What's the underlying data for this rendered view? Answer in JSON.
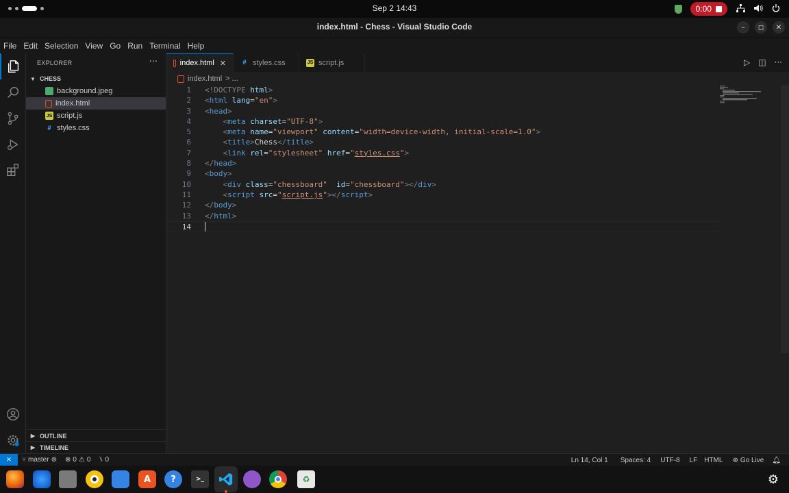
{
  "topbar": {
    "clock": "Sep 2  14:43",
    "recording_time": "0:00"
  },
  "window": {
    "title": "index.html - Chess - Visual Studio Code"
  },
  "menu": [
    "File",
    "Edit",
    "Selection",
    "View",
    "Go",
    "Run",
    "Terminal",
    "Help"
  ],
  "sidebar": {
    "header": "EXPLORER",
    "folder": "CHESS",
    "files": [
      {
        "name": "background.jpeg",
        "type": "img"
      },
      {
        "name": "index.html",
        "type": "html"
      },
      {
        "name": "script.js",
        "type": "js"
      },
      {
        "name": "styles.css",
        "type": "css"
      }
    ],
    "outline": "OUTLINE",
    "timeline": "TIMELINE"
  },
  "tabs": [
    {
      "label": "index.html",
      "type": "html"
    },
    {
      "label": "styles.css",
      "type": "css"
    },
    {
      "label": "script.js",
      "type": "js"
    }
  ],
  "breadcrumb": {
    "file": "index.html",
    "rest": "> ..."
  },
  "code": {
    "line_numbers": [
      "1",
      "2",
      "3",
      "4",
      "5",
      "6",
      "7",
      "8",
      "9",
      "10",
      "11",
      "12",
      "13",
      "14"
    ],
    "l1_doctype": "<!DOCTYPE",
    "l1_html": "html",
    "l1_close": ">",
    "l2_open": "<",
    "l2_tag": "html",
    "l2_attr": "lang",
    "l2_val": "\"en\"",
    "l2_close": ">",
    "l3_tag": "head",
    "l4_tag": "meta",
    "l4_attr": "charset",
    "l4_val": "\"UTF-8\"",
    "l5_tag": "meta",
    "l5_attr1": "name",
    "l5_val1": "\"viewport\"",
    "l5_attr2": "content",
    "l5_val2": "\"width=device-width, initial-scale=1.0\"",
    "l6_tag": "title",
    "l6_text": "Chess",
    "l6_close_tag": "title",
    "l7_tag": "link",
    "l7_attr1": "rel",
    "l7_val1": "\"stylesheet\"",
    "l7_attr2": "href",
    "l7_val2_pre": "\"",
    "l7_val2_link": "styles.css",
    "l7_val2_post": "\"",
    "l8_tag": "head",
    "l9_tag": "body",
    "l10_tag": "div",
    "l10_attr1": "class",
    "l10_val1": "\"chessboard\"",
    "l10_attr2": "id",
    "l10_val2": "\"chessboard\"",
    "l10_close_tag": "div",
    "l11_tag": "script",
    "l11_attr": "src",
    "l11_val_pre": "\"",
    "l11_val_link": "script.js",
    "l11_val_post": "\"",
    "l11_close_tag": "script",
    "l12_tag": "body",
    "l13_tag": "html"
  },
  "statusbar": {
    "branch": "master",
    "errors": "0",
    "warnings": "0",
    "ports": "0",
    "position": "Ln 14, Col 1",
    "spaces": "Spaces: 4",
    "encoding": "UTF-8",
    "eol": "LF",
    "language": "HTML",
    "golive": "Go Live"
  },
  "colors": {
    "accent": "#0078d4",
    "record": "#c01c28"
  }
}
